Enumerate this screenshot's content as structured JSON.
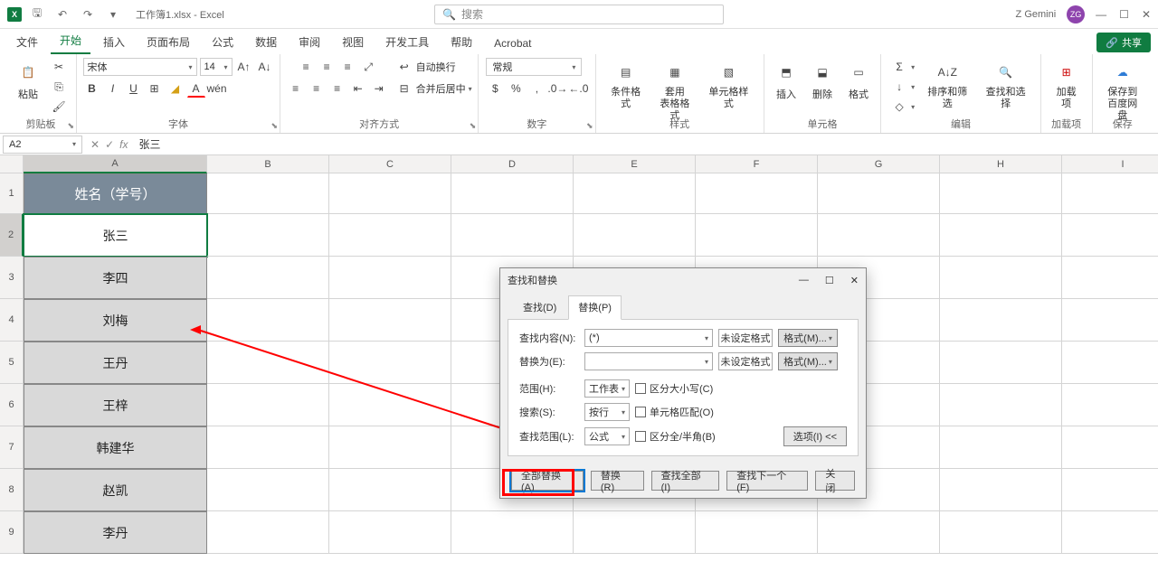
{
  "titlebar": {
    "filename": "工作簿1.xlsx - Excel",
    "search_placeholder": "搜索",
    "user_name": "Z Gemini",
    "user_initials": "ZG"
  },
  "tabs": {
    "file": "文件",
    "home": "开始",
    "insert": "插入",
    "layout": "页面布局",
    "formulas": "公式",
    "data": "数据",
    "review": "审阅",
    "view": "视图",
    "dev": "开发工具",
    "help": "帮助",
    "acrobat": "Acrobat",
    "share": "共享"
  },
  "ribbon": {
    "clipboard": {
      "paste": "粘贴",
      "label": "剪贴板"
    },
    "font": {
      "name": "宋体",
      "size": "14",
      "label": "字体"
    },
    "align": {
      "wrap": "自动换行",
      "merge": "合并后居中",
      "label": "对齐方式"
    },
    "number": {
      "format": "常规",
      "label": "数字"
    },
    "styles": {
      "cond": "条件格式",
      "table": "套用\n表格格式",
      "cell": "单元格样式",
      "label": "样式"
    },
    "cells": {
      "insert": "插入",
      "delete": "删除",
      "fmt": "格式",
      "label": "单元格"
    },
    "editing": {
      "sort": "排序和筛选",
      "find": "查找和选择",
      "label": "编辑"
    },
    "addin": {
      "load": "加载项",
      "label": "加载项"
    },
    "save": {
      "baidu": "保存到\n百度网盘",
      "label": "保存"
    }
  },
  "fxbar": {
    "name": "A2",
    "value": "张三"
  },
  "columns": [
    "A",
    "B",
    "C",
    "D",
    "E",
    "F",
    "G",
    "H",
    "I"
  ],
  "rows": [
    "1",
    "2",
    "3",
    "4",
    "5",
    "6",
    "7",
    "8",
    "9"
  ],
  "sheet": {
    "header": "姓名（学号）",
    "data": [
      "张三",
      "李四",
      "刘梅",
      "王丹",
      "王梓",
      "韩建华",
      "赵凯",
      "李丹"
    ]
  },
  "dialog": {
    "title": "查找和替换",
    "tab_find": "查找(D)",
    "tab_replace": "替换(P)",
    "find_lbl": "查找内容(N):",
    "find_val": "(*)",
    "replace_lbl": "替换为(E):",
    "replace_val": "",
    "no_fmt": "未设定格式",
    "fmt_btn": "格式(M)...",
    "scope_lbl": "范围(H):",
    "scope_val": "工作表",
    "search_lbl": "搜索(S):",
    "search_val": "按行",
    "lookin_lbl": "查找范围(L):",
    "lookin_val": "公式",
    "case": "区分大小写(C)",
    "match": "单元格匹配(O)",
    "width": "区分全/半角(B)",
    "options": "选项(I) <<",
    "btn_replace_all": "全部替换(A)",
    "btn_replace": "替换(R)",
    "btn_find_all": "查找全部(I)",
    "btn_find_next": "查找下一个(F)",
    "btn_close": "关闭"
  }
}
